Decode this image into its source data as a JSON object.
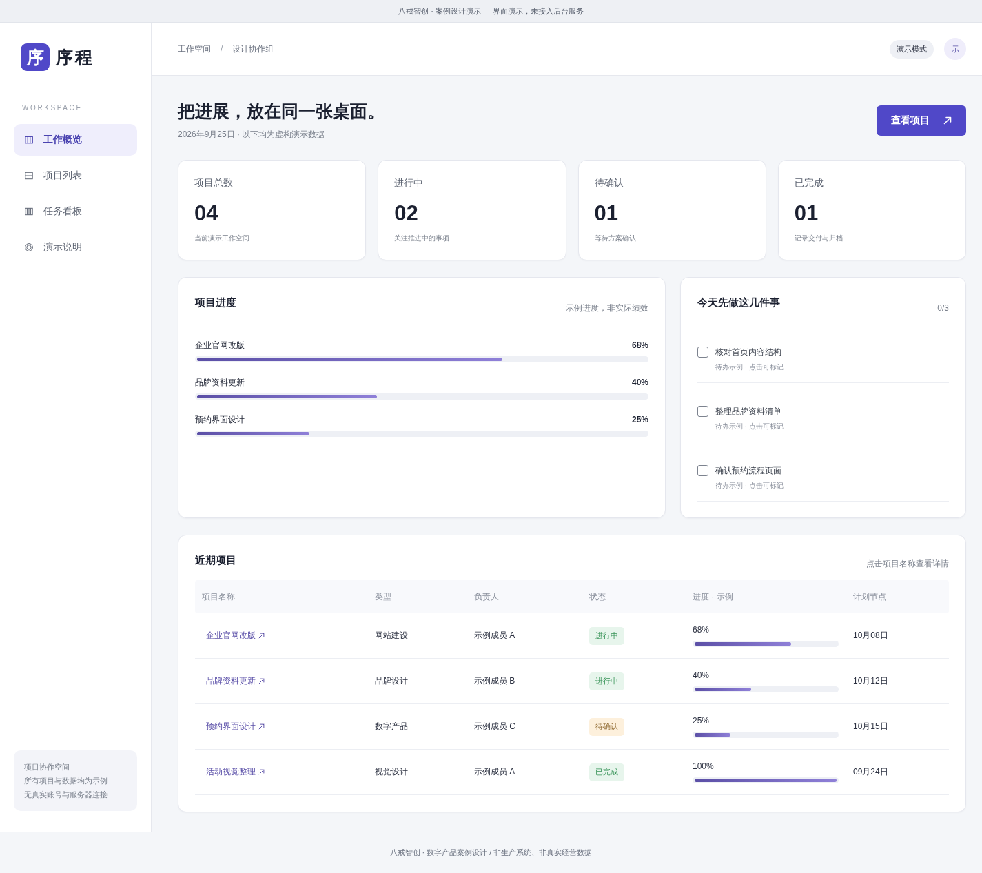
{
  "banner": {
    "left": "八戒智创 · 案例设计演示",
    "right": "界面演示，未接入后台服务"
  },
  "sidebar": {
    "logo": {
      "mark": "序",
      "name": "序程"
    },
    "section_label": "WORKSPACE",
    "items": [
      {
        "label": "工作概览",
        "selected": true
      },
      {
        "label": "项目列表",
        "selected": false
      },
      {
        "label": "任务看板",
        "selected": false
      },
      {
        "label": "演示说明",
        "selected": false
      }
    ],
    "note": [
      "项目协作空间",
      "所有项目与数据均为示例",
      "无真实账号与服务器连接"
    ]
  },
  "header": {
    "breadcrumb": [
      "工作空间",
      "设计协作组"
    ],
    "separator": "/",
    "mode_badge": "演示模式",
    "avatar": "示"
  },
  "hero": {
    "title": "把进展，放在同一张桌面。",
    "subtitle": "2026年9月25日 · 以下均为虚构演示数据",
    "button": "查看项目"
  },
  "stats": [
    {
      "label": "项目总数",
      "value": "04",
      "note": "当前演示工作空间"
    },
    {
      "label": "进行中",
      "value": "02",
      "note": "关注推进中的事项"
    },
    {
      "label": "待确认",
      "value": "01",
      "note": "等待方案确认"
    },
    {
      "label": "已完成",
      "value": "01",
      "note": "记录交付与归档"
    }
  ],
  "progress": {
    "title": "项目进度",
    "note": "示例进度，非实际绩效",
    "items": [
      {
        "name": "企业官网改版",
        "reading": "68%",
        "level": 0.68
      },
      {
        "name": "品牌资料更新",
        "reading": "40%",
        "level": 0.4
      },
      {
        "name": "预约界面设计",
        "reading": "25%",
        "level": 0.25
      }
    ]
  },
  "todo": {
    "title": "今天先做这几件事",
    "count": "0/3",
    "items": [
      {
        "text": "核对首页内容结构",
        "note": "待办示例 · 点击可标记",
        "checked": false
      },
      {
        "text": "整理品牌资料清单",
        "note": "待办示例 · 点击可标记",
        "checked": false
      },
      {
        "text": "确认预约流程页面",
        "note": "待办示例 · 点击可标记",
        "checked": false
      }
    ]
  },
  "recent": {
    "title": "近期项目",
    "note": "点击项目名称查看详情",
    "columns": [
      "项目名称",
      "类型",
      "负责人",
      "状态",
      "进度 · 示例",
      "计划节点"
    ],
    "rows": [
      {
        "name": "企业官网改版",
        "type": "网站建设",
        "owner": "示例成员 A",
        "status": {
          "label": "进行中",
          "color": "#e7f5ec"
        },
        "reading": "68%",
        "level": 0.68,
        "due": "10月08日"
      },
      {
        "name": "品牌资料更新",
        "type": "品牌设计",
        "owner": "示例成员 B",
        "status": {
          "label": "进行中",
          "color": "#e7f5ec"
        },
        "reading": "40%",
        "level": 0.4,
        "due": "10月12日"
      },
      {
        "name": "预约界面设计",
        "type": "数字产品",
        "owner": "示例成员 C",
        "status": {
          "label": "待确认",
          "color": "#fdf0dc"
        },
        "reading": "25%",
        "level": 0.25,
        "due": "10月15日"
      },
      {
        "name": "活动视觉整理",
        "type": "视觉设计",
        "owner": "示例成员 A",
        "status": {
          "label": "已完成",
          "color": "#e7f5ec"
        },
        "reading": "100%",
        "level": 1,
        "due": "09月24日"
      }
    ]
  },
  "footer": "八戒智创 · 数字产品案例设计 / 非生产系统、非真实经营数据"
}
